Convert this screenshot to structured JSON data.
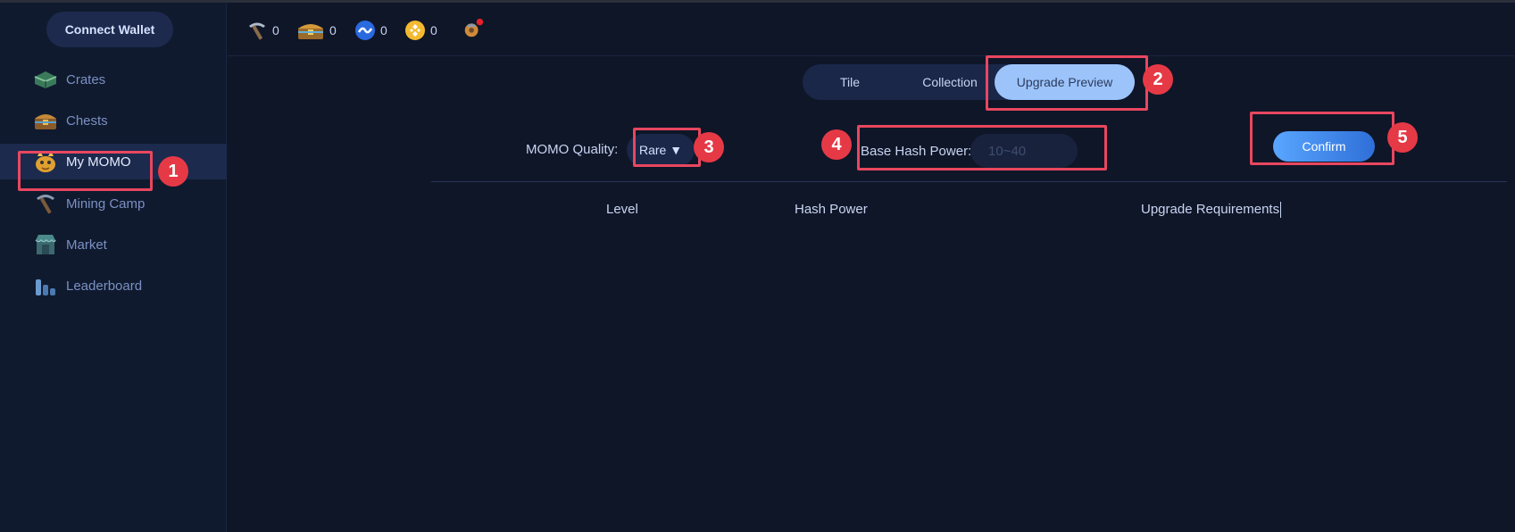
{
  "sidebar": {
    "connect_label": "Connect Wallet",
    "items": [
      {
        "label": "Crates",
        "icon": "crate-icon"
      },
      {
        "label": "Chests",
        "icon": "chest-icon"
      },
      {
        "label": "My MOMO",
        "icon": "momo-icon",
        "active": true
      },
      {
        "label": "Mining Camp",
        "icon": "pickaxe-icon"
      },
      {
        "label": "Market",
        "icon": "market-icon"
      },
      {
        "label": "Leaderboard",
        "icon": "leaderboard-icon"
      }
    ]
  },
  "topbar": {
    "assets": [
      {
        "icon": "pickaxe-icon",
        "value": "0"
      },
      {
        "icon": "chest-icon",
        "value": "0"
      },
      {
        "icon": "token-icon",
        "value": "0"
      },
      {
        "icon": "bnb-icon",
        "value": "0"
      }
    ],
    "notification_icon": "notification-icon"
  },
  "tabs": [
    "Tile",
    "Collection",
    "Upgrade Preview"
  ],
  "active_tab": "Upgrade Preview",
  "filters": {
    "quality_label": "MOMO Quality:",
    "quality_value": "Rare ▼",
    "hash_label": "Base Hash Power:",
    "hash_placeholder": "10~40",
    "confirm_label": "Confirm"
  },
  "table": {
    "headers": [
      "Level",
      "Hash Power",
      "Upgrade Requirements"
    ]
  },
  "annotations": [
    "1",
    "2",
    "3",
    "4",
    "5"
  ],
  "colors": {
    "background": "#0f1628",
    "sidebar_active": "#1c2a4d",
    "tab_active": "#9cc4fb",
    "confirm": "#4a90f0",
    "annotation": "#e63946"
  }
}
